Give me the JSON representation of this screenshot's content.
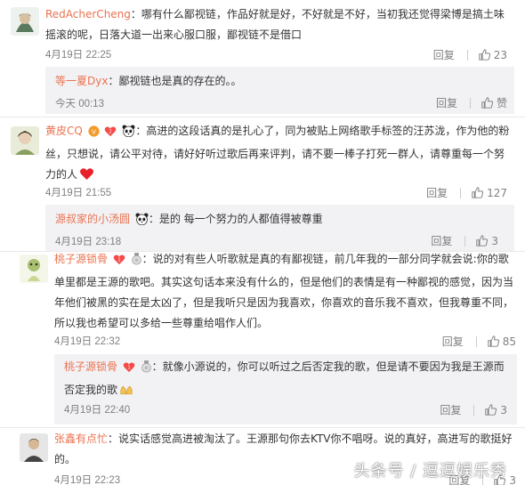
{
  "reply_label": "回复",
  "like_label_zan": "赞",
  "comments": [
    {
      "user": "RedAcherCheng",
      "text_line1": "：哪有什么鄙视链，作品好就是好，不好就是不好，当初我还觉得梁博是搞土味",
      "text_line2": "摇滚的呢，日落大道一出来心服口服，鄙视链不是借口",
      "time": "4月19日 22:25",
      "likes": "23",
      "reply": {
        "user": "等一夏Dyx",
        "text": "：鄙视链也是真的存在的。。",
        "time": "今天 00:13",
        "likes": "赞"
      }
    },
    {
      "user": "黄皮CQ",
      "text_line1": "：高进的这段话真的是扎心了，同为被贴上网络歌手标签的汪苏泷，作为他的粉",
      "text_line2": "丝，只想说，请公平对待，请好好听过歌后再来评判，请不要一棒子打死一群人，请尊重每一个努",
      "text_line3": "力的人",
      "time": "4月19日 21:55",
      "likes": "127",
      "reply": {
        "user": "源叔家的小汤圆",
        "text": "：是的 每一个努力的人都值得被尊重",
        "time": "4月19日 23:18",
        "likes": "3"
      }
    },
    {
      "user": "桃子源锁骨",
      "text_line1": "：说的对有些人听歌就是真的有鄙视链，前几年我的一部分同学就会说:你的歌",
      "text_line2": "单里都是王源的歌吧。其实这句话本来没有什么的，但是他们的表情是有一种鄙视的感觉，因为当",
      "text_line3": "年他们被黑的实在是太凶了，但是我听只是因为我喜欢，你喜欢的音乐我不喜欢，但我尊重不同，",
      "text_line4": "所以我也希望可以多给一些尊重给唱作人们。",
      "time": "4月19日 22:32",
      "likes": "85",
      "reply": {
        "user": "桃子源锁骨",
        "text_line1": "：就像小源说的，你可以听过之后否定我的歌，但是请不要因为我是王源而",
        "text_line2": "否定我的歌",
        "time": "4月19日 22:40",
        "likes": "3"
      }
    },
    {
      "user": "张鑫有点忙",
      "text_line1": "：说实话感觉高进被淘汰了。王源那句你去KTV你不唱呀。说的真好，高进写的歌挺好",
      "text_line2": "的。",
      "time": "4月19日 22:23",
      "likes": "3"
    }
  ],
  "watermark": "头条号 / 逗逗娱乐秀",
  "colors": {
    "username": "#eb7350",
    "meta": "#808080",
    "reply_bg": "#f2f2f5"
  }
}
